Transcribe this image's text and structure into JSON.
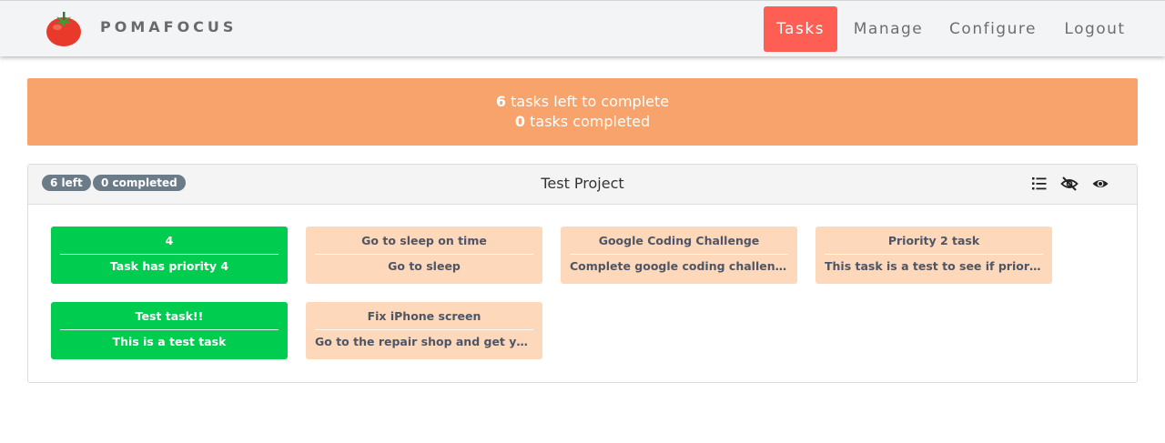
{
  "navbar": {
    "brand": "POMAFOCUS",
    "items": [
      {
        "label": "Tasks",
        "active": true
      },
      {
        "label": "Manage"
      },
      {
        "label": "Configure"
      },
      {
        "label": "Logout"
      }
    ],
    "active_color": "#ff5e55"
  },
  "summary": {
    "left_count": "6",
    "left_text": " tasks left to complete",
    "completed_count": "0",
    "completed_text": " tasks completed",
    "color": "#f7a36b"
  },
  "project": {
    "badge_left": "6 left",
    "badge_completed": "0 completed",
    "title": "Test Project",
    "icons": [
      "list-icon",
      "eye-slash-icon",
      "eye-icon"
    ]
  },
  "tasks": [
    {
      "title": "4",
      "description": "Task has priority 4",
      "color": "green"
    },
    {
      "title": "Go to sleep on time",
      "description": "Go to sleep",
      "color": "peach"
    },
    {
      "title": "Google Coding Challenge",
      "description": "Complete google coding challenge again",
      "color": "peach"
    },
    {
      "title": "Priority 2 task",
      "description": "This task is a test to see if priority is s...",
      "color": "peach"
    },
    {
      "title": "Test task!!",
      "description": "This is a test task",
      "color": "green"
    },
    {
      "title": "Fix iPhone screen",
      "description": "Go to the repair shop and get your scr...",
      "color": "peach"
    }
  ]
}
